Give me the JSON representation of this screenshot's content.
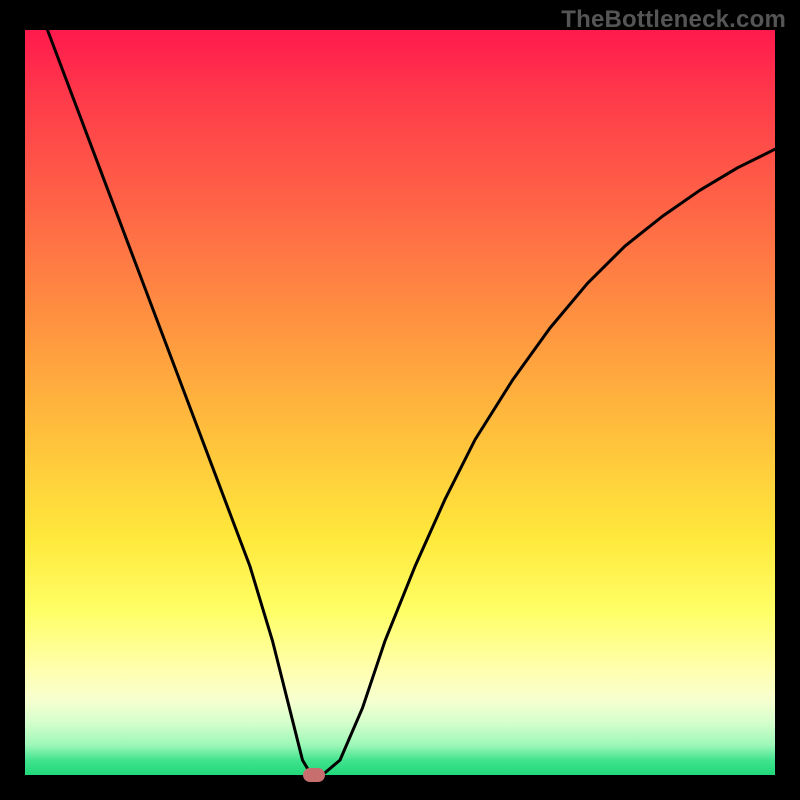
{
  "watermark": "TheBottleneck.com",
  "chart_data": {
    "type": "line",
    "title": "",
    "xlabel": "",
    "ylabel": "",
    "xlim": [
      0,
      100
    ],
    "ylim": [
      0,
      100
    ],
    "x": [
      0,
      3,
      6,
      9,
      12,
      15,
      18,
      21,
      24,
      27,
      30,
      33,
      36,
      37,
      38,
      39,
      40,
      42,
      45,
      48,
      52,
      56,
      60,
      65,
      70,
      75,
      80,
      85,
      90,
      95,
      100
    ],
    "y": [
      108,
      100,
      92,
      84,
      76,
      68,
      60,
      52,
      44,
      36,
      28,
      18,
      6,
      2,
      0.3,
      0.2,
      0.3,
      2,
      9,
      18,
      28,
      37,
      45,
      53,
      60,
      66,
      71,
      75,
      78.5,
      81.5,
      84
    ],
    "marker": {
      "x": 38.5,
      "y": 0
    },
    "gradient_stops": [
      {
        "pos": 0,
        "color": "#ff1a4d"
      },
      {
        "pos": 25,
        "color": "#ff6846"
      },
      {
        "pos": 55,
        "color": "#ffc23c"
      },
      {
        "pos": 78,
        "color": "#ffff66"
      },
      {
        "pos": 93,
        "color": "#d4ffcc"
      },
      {
        "pos": 100,
        "color": "#1fd97a"
      }
    ]
  }
}
